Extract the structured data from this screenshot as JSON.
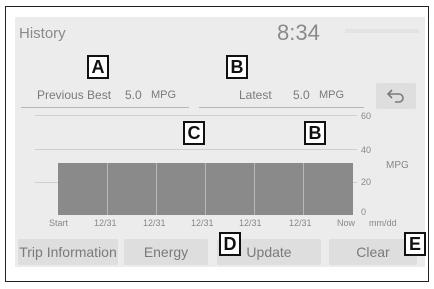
{
  "screen": {
    "title": "History",
    "clock": "8:34"
  },
  "previous_best": {
    "label": "Previous Best",
    "value": "5.0",
    "unit": "MPG"
  },
  "latest": {
    "label": "Latest",
    "value": "5.0",
    "unit": "MPG"
  },
  "chart": {
    "y_unit": "MPG",
    "y_ticks": [
      "60",
      "40",
      "20",
      "0"
    ],
    "x_ticks": [
      "Start",
      "12/31",
      "12/31",
      "12/31",
      "12/31",
      "12/31",
      "Now"
    ],
    "x_unit": "mm/dd"
  },
  "buttons": {
    "trip_information": "Trip Information",
    "energy": "Energy",
    "update": "Update",
    "clear": "Clear"
  },
  "callouts": {
    "a": "A",
    "b_top": "B",
    "c": "C",
    "b_chart": "B",
    "d": "D",
    "e": "E"
  },
  "icons": {
    "back": "back-arrow-icon"
  }
}
